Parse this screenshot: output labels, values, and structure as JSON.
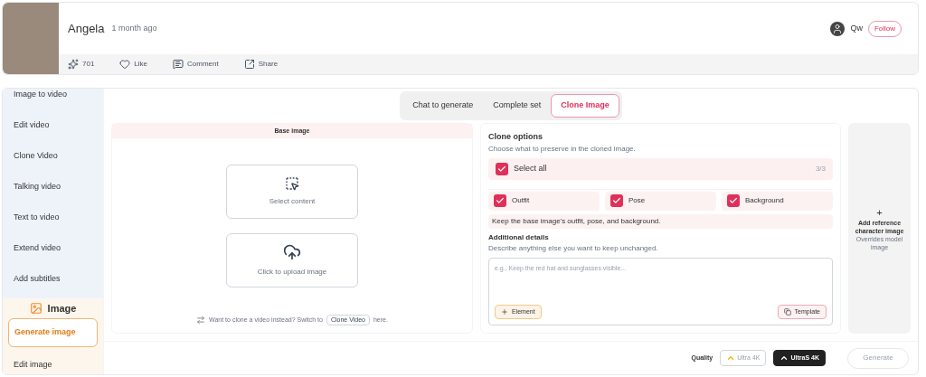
{
  "post": {
    "author": "Angela",
    "time": "1 month ago",
    "stats": [
      {
        "kind": "spark",
        "label": "701"
      },
      {
        "kind": "heart",
        "label": "Like"
      },
      {
        "kind": "comment",
        "label": "Comment"
      },
      {
        "kind": "share",
        "label": "Share"
      }
    ],
    "follower": {
      "name": "Qw",
      "button": "Follow"
    }
  },
  "sidebar": {
    "video_items": [
      {
        "label": "Image to video",
        "selected": false
      },
      {
        "label": "Edit video",
        "selected": false
      },
      {
        "label": "Clone Video",
        "selected": false
      },
      {
        "label": "Talking video",
        "selected": false
      },
      {
        "label": "Text to video",
        "selected": false
      },
      {
        "label": "Extend video",
        "selected": false
      },
      {
        "label": "Add subtitles",
        "selected": false
      }
    ],
    "image_section": "Image",
    "image_items": [
      {
        "label": "Generate image",
        "selected": true
      },
      {
        "label": "Edit image",
        "selected": false
      }
    ]
  },
  "tabs": [
    {
      "label": "Chat to generate",
      "selected": false
    },
    {
      "label": "Complete set",
      "selected": false
    },
    {
      "label": "Clone Image",
      "selected": true
    }
  ],
  "base_image": {
    "title": "Base image",
    "select": "Select content",
    "upload": "Click to upload image",
    "hint_before": "Want to clone a video instead? Switch to",
    "hint_link": "Clone Video",
    "hint_after": "here."
  },
  "clone_options": {
    "title": "Clone options",
    "subtitle": "Choose what to preserve in the cloned image.",
    "select_all": {
      "label": "Select all",
      "checked": true,
      "count": "3/3"
    },
    "options": [
      {
        "label": "Outfit",
        "checked": true
      },
      {
        "label": "Pose",
        "checked": true
      },
      {
        "label": "Background",
        "checked": true
      }
    ],
    "summary": "Keep the base image's outfit, pose, and background.",
    "details_title": "Additional details",
    "details_subtitle": "Describe anything else you want to keep unchanged.",
    "placeholder": "e.g., Keep the red hat and sunglasses visible...",
    "element_button": "Element",
    "template_button": "Template"
  },
  "reference": {
    "plus": "+",
    "title": "Add reference character image",
    "subtitle": "Overrides model image"
  },
  "footer": {
    "quality_label": "Quality",
    "qualities": [
      {
        "label": "Ultra 4K",
        "selected": false
      },
      {
        "label": "UltraS 4K",
        "selected": true
      }
    ],
    "generate": {
      "label": "Generate",
      "disabled": true
    }
  }
}
